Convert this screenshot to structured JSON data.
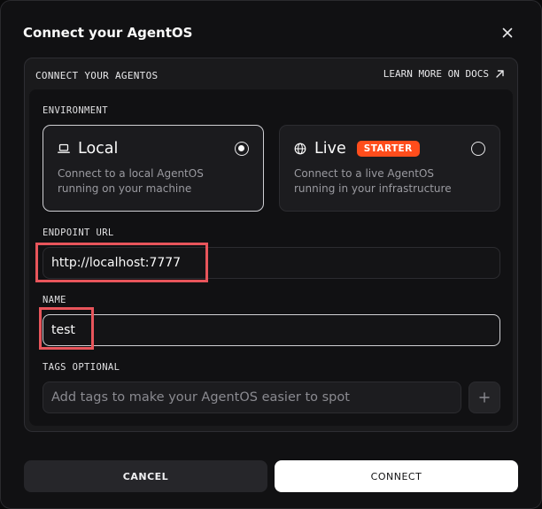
{
  "dialog": {
    "title": "Connect your AgentOS"
  },
  "panel": {
    "header_label": "CONNECT YOUR AGENTOS",
    "docs_link_label": "LEARN MORE ON DOCS"
  },
  "environment": {
    "label": "ENVIRONMENT",
    "options": [
      {
        "title": "Local",
        "description": "Connect to a local AgentOS running on your machine",
        "selected": true,
        "icon": "laptop-icon"
      },
      {
        "title": "Live",
        "badge": "STARTER",
        "description": "Connect to a live AgentOS running in your infrastructure",
        "selected": false,
        "icon": "globe-icon"
      }
    ]
  },
  "endpoint": {
    "label": "ENDPOINT URL",
    "value": "http://localhost:7777"
  },
  "name_field": {
    "label": "NAME",
    "value": "test"
  },
  "tags": {
    "label": "TAGS OPTIONAL",
    "placeholder": "Add tags to make your AgentOS easier to spot"
  },
  "footer": {
    "cancel_label": "CANCEL",
    "connect_label": "CONNECT"
  },
  "colors": {
    "badge": "#ff4d1c",
    "highlight": "#e8555b",
    "background": "#111113"
  }
}
